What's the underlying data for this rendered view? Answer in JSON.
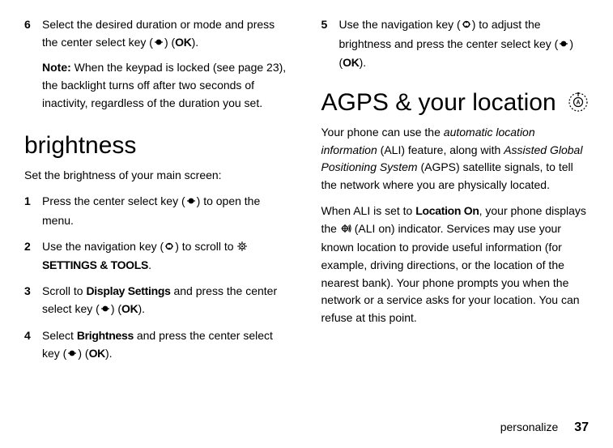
{
  "left": {
    "step6": {
      "num": "6",
      "part1": "Select the desired duration or mode and press the center select key (",
      "part2": ") (",
      "ok": "OK",
      "part3": ").",
      "note_label": "Note:",
      "note_body": " When the keypad is locked (see page 23), the backlight turns off after two seconds of inactivity, regardless of the duration you set."
    },
    "heading": "brightness",
    "intro": "Set the brightness of your main screen:",
    "step1": {
      "num": "1",
      "part1": "Press the center select key (",
      "part2": ") to open the menu."
    },
    "step2": {
      "num": "2",
      "part1": "Use the navigation key (",
      "part2": ") to scroll to ",
      "label": "SETTINGS & TOOLS",
      "part3": "."
    },
    "step3": {
      "num": "3",
      "part1": "Scroll to ",
      "label": "Display Settings",
      "part2": " and press the center select key (",
      "part3": ") (",
      "ok": "OK",
      "part4": ")."
    },
    "step4": {
      "num": "4",
      "part1": "Select ",
      "label": "Brightness",
      "part2": " and press the center select key (",
      "part3": ") (",
      "ok": "OK",
      "part4": ")."
    }
  },
  "right": {
    "step5": {
      "num": "5",
      "part1": "Use the navigation key (",
      "part2": ") to adjust the brightness and press the center select key (",
      "part3": ") (",
      "ok": "OK",
      "part4": ")."
    },
    "heading": "AGPS & your location",
    "para1": {
      "p1": "Your phone can use the ",
      "term1": "automatic location information",
      "p2": " (ALI) feature, along with ",
      "term2": "Assisted Global Positioning System",
      "p3": " (AGPS) satellite signals, to tell the network where you are physically located."
    },
    "para2": {
      "p1": "When ALI is set to ",
      "label": "Location On",
      "p2": ", your phone displays the ",
      "p3": " (ALI on) indicator. Services may use your known location to provide useful information (for example, driving directions, or the location of the nearest bank). Your phone prompts you when the network or a service asks for your location. You can refuse at this point."
    }
  },
  "footer": {
    "section": "personalize",
    "page": "37"
  }
}
